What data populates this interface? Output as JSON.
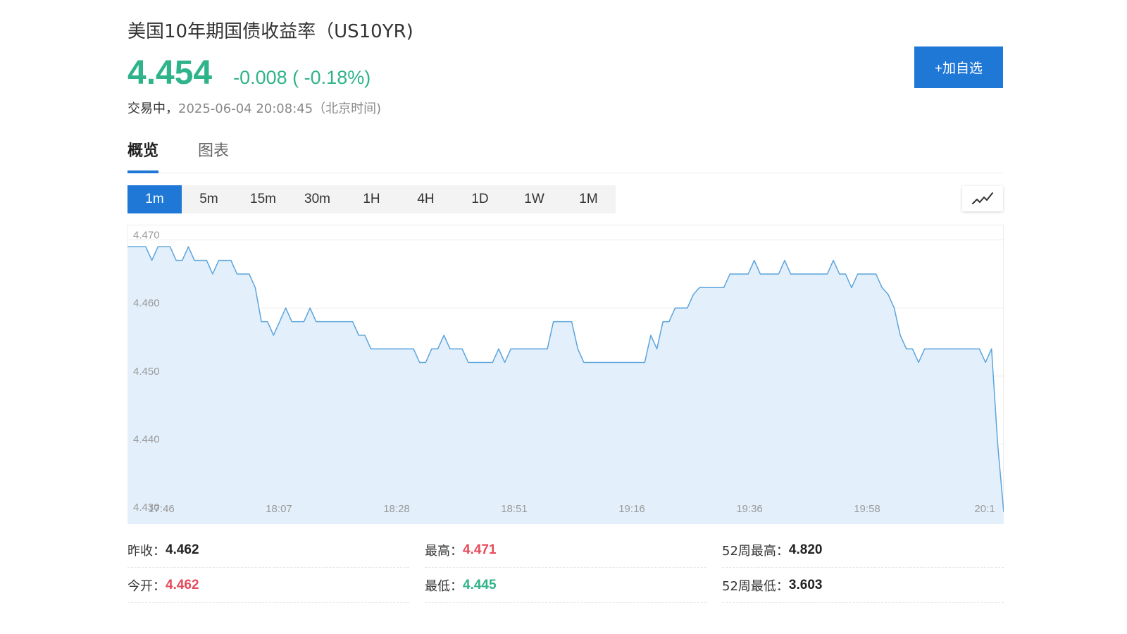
{
  "header": {
    "title": "美国10年期国债收益率（US10YR)",
    "price": "4.454",
    "change": "-0.008 ( -0.18%)",
    "status": "交易中，",
    "timestamp": "2025-06-04 20:08:45（北京时间)",
    "add_button": "+加自选"
  },
  "colors": {
    "down": "#2fb38a",
    "up": "#e54b5b",
    "accent": "#1f77d6",
    "line": "#5ba4dc",
    "fill": "#e3f0fc"
  },
  "tabs": [
    {
      "label": "概览",
      "active": true
    },
    {
      "label": "图表",
      "active": false
    }
  ],
  "intervals": [
    {
      "label": "1m",
      "active": true
    },
    {
      "label": "5m",
      "active": false
    },
    {
      "label": "15m",
      "active": false
    },
    {
      "label": "30m",
      "active": false
    },
    {
      "label": "1H",
      "active": false
    },
    {
      "label": "4H",
      "active": false
    },
    {
      "label": "1D",
      "active": false
    },
    {
      "label": "1W",
      "active": false
    },
    {
      "label": "1M",
      "active": false
    }
  ],
  "chart_type_icon": "line-chart-icon",
  "chart_data": {
    "type": "area",
    "y_ticks": [
      "4.470",
      "4.460",
      "4.450",
      "4.440",
      "4.430"
    ],
    "ylim": [
      4.43,
      4.471
    ],
    "x_ticks": [
      "17:46",
      "18:07",
      "18:28",
      "18:51",
      "19:16",
      "19:36",
      "19:58",
      "20:1"
    ],
    "grid": true,
    "series": [
      {
        "values": [
          4.469,
          4.469,
          4.469,
          4.469,
          4.467,
          4.469,
          4.469,
          4.469,
          4.467,
          4.467,
          4.469,
          4.467,
          4.467,
          4.467,
          4.465,
          4.467,
          4.467,
          4.467,
          4.465,
          4.465,
          4.465,
          4.463,
          4.458,
          4.458,
          4.456,
          4.458,
          4.46,
          4.458,
          4.458,
          4.458,
          4.46,
          4.458,
          4.458,
          4.458,
          4.458,
          4.458,
          4.458,
          4.458,
          4.456,
          4.456,
          4.454,
          4.454,
          4.454,
          4.454,
          4.454,
          4.454,
          4.454,
          4.454,
          4.452,
          4.452,
          4.454,
          4.454,
          4.456,
          4.454,
          4.454,
          4.454,
          4.452,
          4.452,
          4.452,
          4.452,
          4.452,
          4.454,
          4.452,
          4.454,
          4.454,
          4.454,
          4.454,
          4.454,
          4.454,
          4.454,
          4.458,
          4.458,
          4.458,
          4.458,
          4.454,
          4.452,
          4.452,
          4.452,
          4.452,
          4.452,
          4.452,
          4.452,
          4.452,
          4.452,
          4.452,
          4.452,
          4.456,
          4.454,
          4.458,
          4.458,
          4.46,
          4.46,
          4.46,
          4.462,
          4.463,
          4.463,
          4.463,
          4.463,
          4.463,
          4.465,
          4.465,
          4.465,
          4.465,
          4.467,
          4.465,
          4.465,
          4.465,
          4.465,
          4.467,
          4.465,
          4.465,
          4.465,
          4.465,
          4.465,
          4.465,
          4.465,
          4.467,
          4.465,
          4.465,
          4.463,
          4.465,
          4.465,
          4.465,
          4.465,
          4.463,
          4.462,
          4.46,
          4.456,
          4.454,
          4.454,
          4.452,
          4.454,
          4.454,
          4.454,
          4.454,
          4.454,
          4.454,
          4.454,
          4.454,
          4.454,
          4.454,
          4.452,
          4.454,
          4.44,
          4.43
        ]
      }
    ]
  },
  "stats": [
    {
      "label": "昨收：",
      "value": "4.462",
      "tone": "neutral"
    },
    {
      "label": "最高：",
      "value": "4.471",
      "tone": "up"
    },
    {
      "label": "52周最高：",
      "value": "4.820",
      "tone": "neutral"
    },
    {
      "label": "今开：",
      "value": "4.462",
      "tone": "up"
    },
    {
      "label": "最低：",
      "value": "4.445",
      "tone": "down"
    },
    {
      "label": "52周最低：",
      "value": "3.603",
      "tone": "neutral"
    }
  ]
}
